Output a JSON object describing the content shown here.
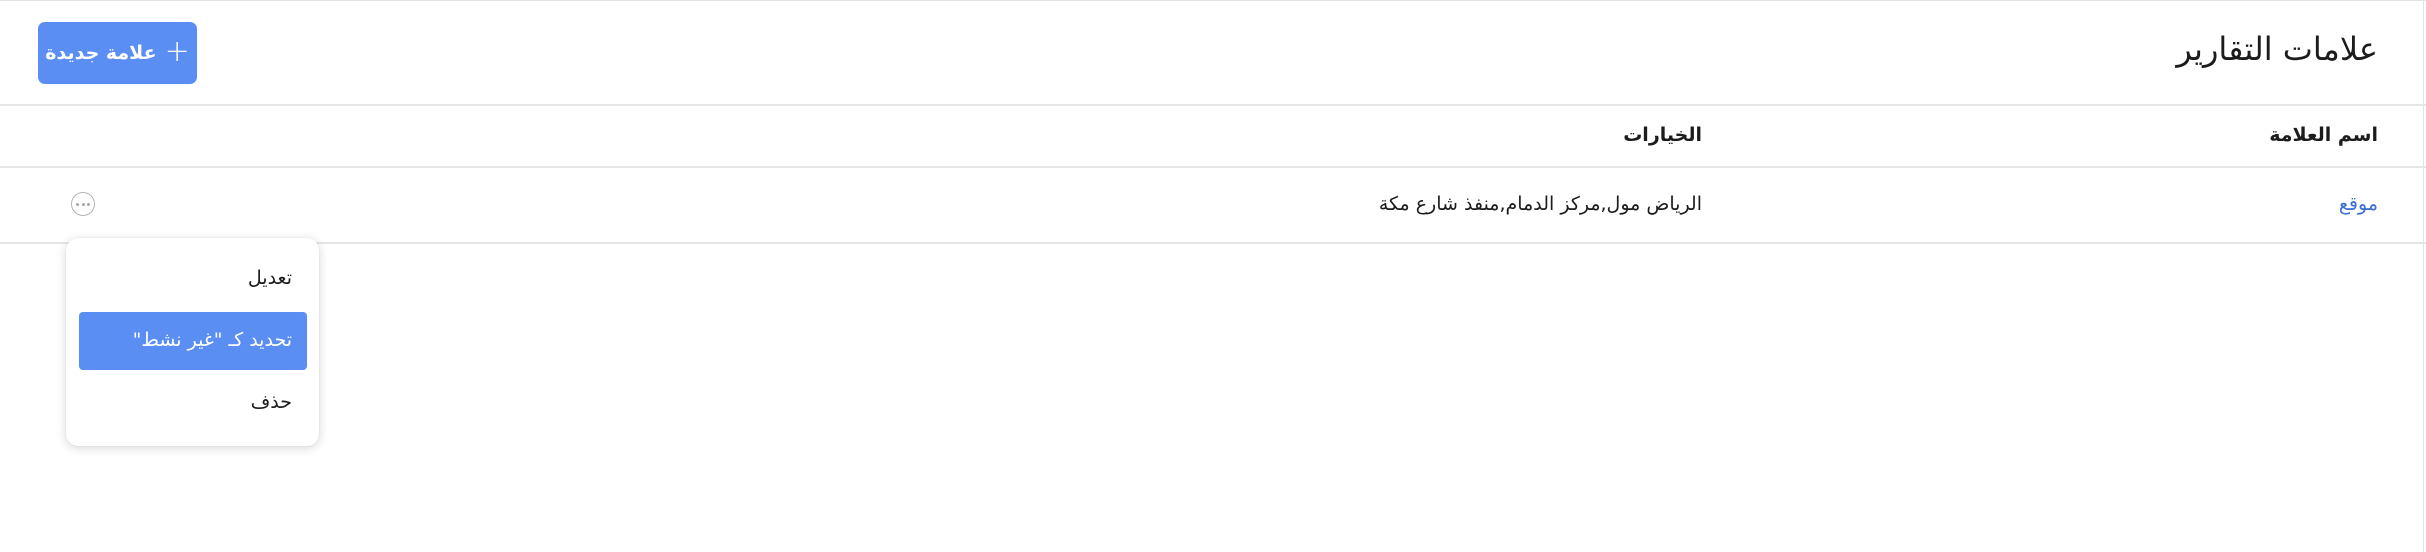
{
  "header": {
    "title": "علامات التقارير",
    "new_tag_label": "علامة جديدة",
    "new_tag_icon": "plus-icon"
  },
  "table": {
    "columns": [
      "اسم العلامة",
      "الخيارات"
    ],
    "rows": [
      {
        "name": "موقع",
        "options": "الرياض مول,مركز الدمام,منفذ شارع مكة"
      }
    ]
  },
  "row_menu": {
    "items": [
      {
        "label": "تعديل",
        "active": false
      },
      {
        "label": "تحديد كـ \"غير نشط\"",
        "active": true
      },
      {
        "label": "حذف",
        "active": false
      }
    ]
  },
  "colors": {
    "accent": "#5a8ef2",
    "link": "#3a6fd6",
    "divider": "#e6e6e6"
  }
}
